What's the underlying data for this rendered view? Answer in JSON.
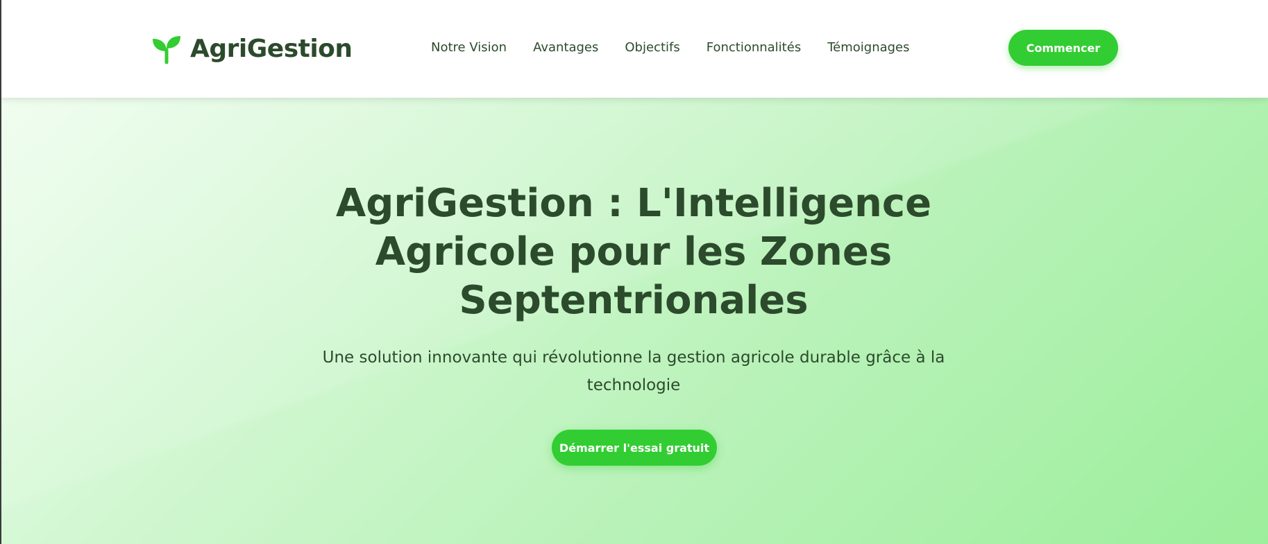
{
  "brand": {
    "icon": "sprout-icon",
    "name": "AgriGestion",
    "color": "#32cd32"
  },
  "nav": {
    "items": [
      {
        "label": "Notre Vision"
      },
      {
        "label": "Avantages"
      },
      {
        "label": "Objectifs"
      },
      {
        "label": "Fonctionnalités"
      },
      {
        "label": "Témoignages"
      }
    ]
  },
  "header": {
    "cta_label": "Commencer"
  },
  "hero": {
    "title": "AgriGestion : L'Intelligence Agricole pour les Zones Septentrionales",
    "subtitle": "Une solution innovante qui révolutionne la gestion agricole durable grâce à la technologie",
    "cta_label": "Démarrer l'essai gratuit"
  },
  "colors": {
    "accent": "#32cd32",
    "text": "#2c4a2c",
    "hero_gradient_start": "#ecfcec",
    "hero_gradient_end": "#9cee9c"
  }
}
